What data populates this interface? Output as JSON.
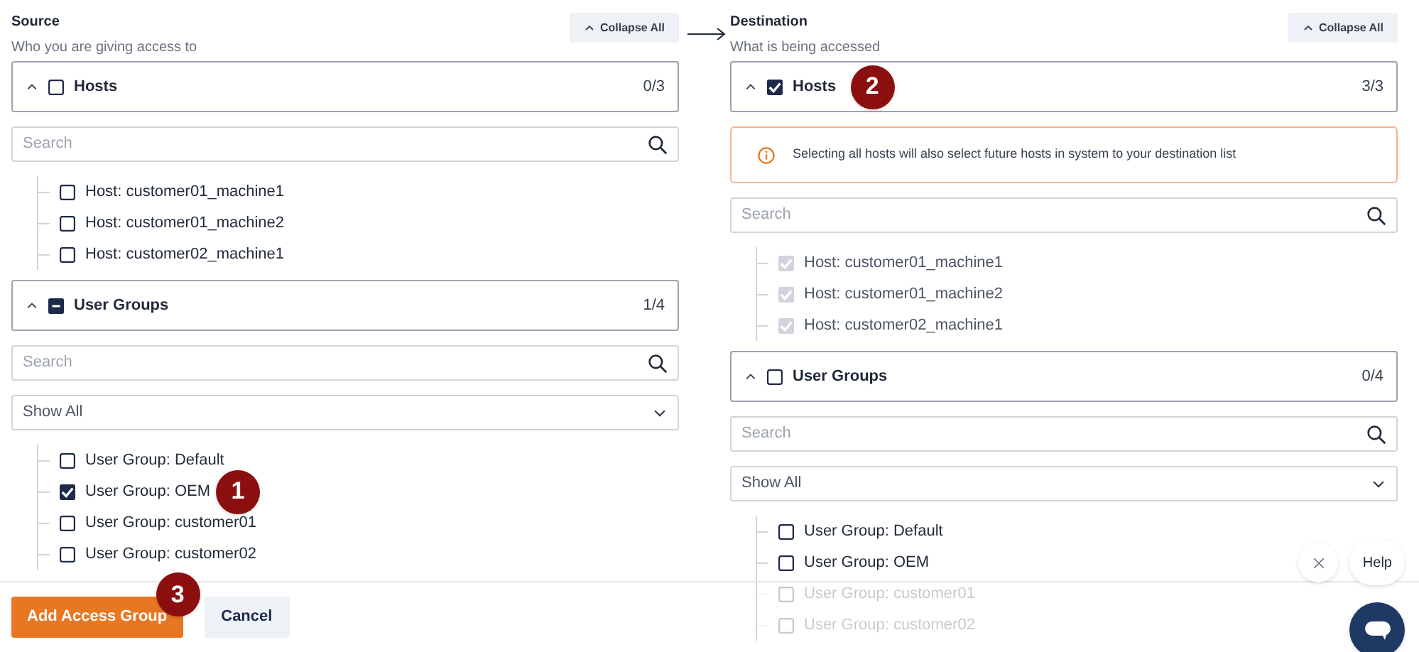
{
  "columns": [
    {
      "title": "Source",
      "subtitle": "Who you are giving access to",
      "collapse_button": "Collapse All",
      "sections": [
        {
          "kind": "group",
          "label": "Hosts",
          "checked": false,
          "partial": false,
          "expanded": true,
          "count": "0/3",
          "search": {
            "placeholder": "Search"
          },
          "items": [
            {
              "label": "Host: customer01_machine1",
              "checked": false,
              "disabled": false
            },
            {
              "label": "Host: customer01_machine2",
              "checked": false,
              "disabled": false
            },
            {
              "label": "Host: customer02_machine1",
              "checked": false,
              "disabled": false
            }
          ]
        },
        {
          "kind": "group",
          "label": "User Groups",
          "checked": false,
          "partial": true,
          "expanded": true,
          "count": "1/4",
          "search": {
            "placeholder": "Search"
          },
          "filter": "Show All",
          "items": [
            {
              "label": "User Group: Default",
              "checked": false,
              "disabled": false
            },
            {
              "label": "User Group: OEM",
              "checked": true,
              "disabled": false,
              "marker": "1"
            },
            {
              "label": "User Group: customer01",
              "checked": false,
              "disabled": false
            },
            {
              "label": "User Group: customer02",
              "checked": false,
              "disabled": false
            }
          ]
        }
      ]
    },
    {
      "title": "Destination",
      "subtitle": "What is being accessed",
      "collapse_button": "Collapse All",
      "sections": [
        {
          "kind": "group",
          "label": "Hosts",
          "checked": true,
          "partial": false,
          "expanded": true,
          "count": "3/3",
          "marker": "2",
          "alert": "Selecting all hosts will also select future hosts in system to your destination list",
          "search": {
            "placeholder": "Search"
          },
          "items": [
            {
              "label": "Host: customer01_machine1",
              "checked": true,
              "disabled": true
            },
            {
              "label": "Host: customer01_machine2",
              "checked": true,
              "disabled": true
            },
            {
              "label": "Host: customer02_machine1",
              "checked": true,
              "disabled": true
            }
          ]
        },
        {
          "kind": "group",
          "label": "User Groups",
          "checked": false,
          "partial": false,
          "expanded": true,
          "count": "0/4",
          "search": {
            "placeholder": "Search"
          },
          "filter": "Show All",
          "items": [
            {
              "label": "User Group: Default",
              "checked": false,
              "disabled": false
            },
            {
              "label": "User Group: OEM",
              "checked": false,
              "disabled": false
            },
            {
              "label": "User Group: customer01",
              "checked": false,
              "disabled": false,
              "dimmed": true
            },
            {
              "label": "User Group: customer02",
              "checked": false,
              "disabled": false,
              "dimmed": true
            }
          ]
        }
      ]
    }
  ],
  "footer": {
    "primary_button": "Add Access Group",
    "primary_marker": "3",
    "secondary_button": "Cancel"
  },
  "help_widget": {
    "label": "Help"
  }
}
